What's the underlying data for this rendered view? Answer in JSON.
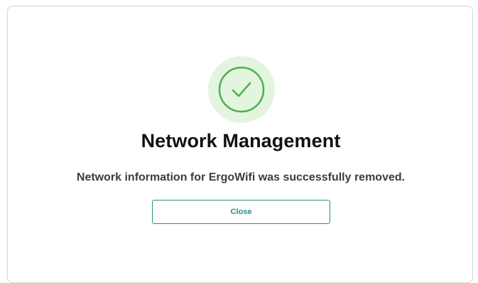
{
  "dialog": {
    "title": "Network Management",
    "message": "Network information for ErgoWifi was successfully removed.",
    "close_label": "Close",
    "status_icon": "checkmark-circle-icon"
  },
  "colors": {
    "success_green": "#4caf50",
    "success_green_bg": "#e3f5df",
    "button_accent": "#2b8e86",
    "title_text": "#111111",
    "message_text": "#3d3d3d"
  }
}
